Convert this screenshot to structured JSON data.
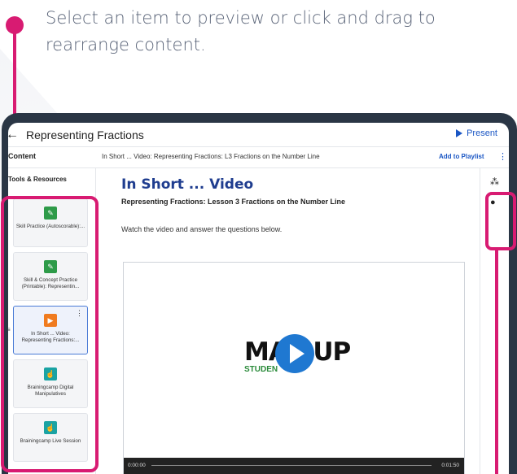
{
  "instruction": "Select an item to preview or click and drag to rearrange content.",
  "app": {
    "title": "Representing Fractions",
    "present_label": "Present"
  },
  "subbar": {
    "content_tab": "Content",
    "breadcrumb": "In Short ... Video: Representing Fractions: L3 Fractions on the Number Line",
    "add_to_playlist": "Add to Playlist",
    "more": "⋮"
  },
  "rail": {
    "tools_label": "Tools & Resources",
    "items": [
      {
        "title": "Skill Practice (Autoscorable):...",
        "icon": "edit-doc-icon",
        "color": "#2e9b49"
      },
      {
        "title": "Skill & Concept Practice (Printable): Representin...",
        "icon": "edit-doc-icon",
        "color": "#2e9b49"
      },
      {
        "title": "In Short ... Video: Representing Fractions:...",
        "icon": "play-icon",
        "color": "#f07b1f"
      },
      {
        "title": "Brainingcamp Digital Manipulatives",
        "icon": "pointer-hand-icon",
        "color": "#1aa3a3"
      },
      {
        "title": "Brainingcamp Live Session",
        "icon": "pointer-hand-icon",
        "color": "#1aa3a3"
      }
    ]
  },
  "main": {
    "heading": "In Short ... Video",
    "subtitle": "Representing Fractions: Lesson 3 Fractions on the Number Line",
    "instruction": "Watch the video and answer the questions below.",
    "player": {
      "logo_text": "MAP UP",
      "logo_sub": "STUDEN",
      "time_start": "0:00:00",
      "time_end": "0:01:50"
    }
  },
  "colors": {
    "highlight": "#d81b72",
    "accent": "#1a56c4",
    "heading": "#1f3d8f"
  }
}
